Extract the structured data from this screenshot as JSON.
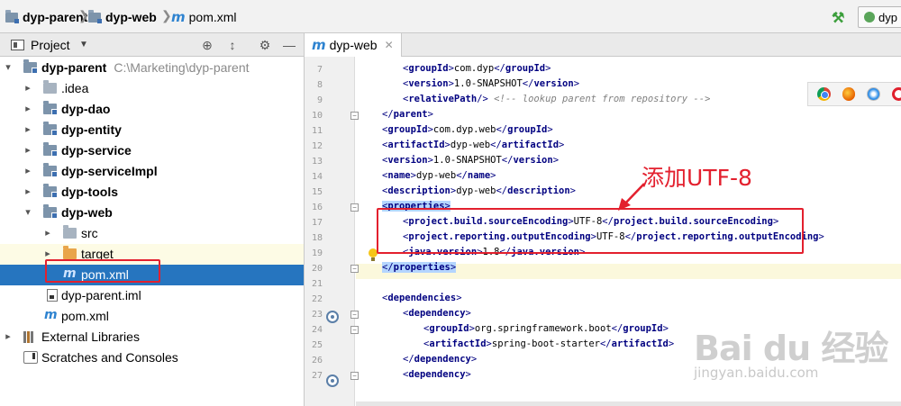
{
  "breadcrumb": {
    "items": [
      "dyp-parent",
      "dyp-web",
      "pom.xml"
    ]
  },
  "toolbar": {
    "run_config_label": "dyp"
  },
  "project_panel": {
    "title": "Project"
  },
  "tree": {
    "root_label": "dyp-parent",
    "root_path": "C:\\Marketing\\dyp-parent",
    "items": [
      {
        "label": ".idea"
      },
      {
        "label": "dyp-dao"
      },
      {
        "label": "dyp-entity"
      },
      {
        "label": "dyp-service"
      },
      {
        "label": "dyp-serviceImpl"
      },
      {
        "label": "dyp-tools"
      },
      {
        "label": "dyp-web"
      },
      {
        "label": "src"
      },
      {
        "label": "target"
      },
      {
        "label": "pom.xml"
      },
      {
        "label": "dyp-parent.iml"
      },
      {
        "label": "pom.xml"
      },
      {
        "label": "External Libraries"
      },
      {
        "label": "Scratches and Consoles"
      }
    ]
  },
  "editor": {
    "tab_label": "dyp-web",
    "line_numbers": [
      "7",
      "8",
      "9",
      "10",
      "11",
      "12",
      "13",
      "14",
      "15",
      "16",
      "17",
      "18",
      "19",
      "20",
      "21",
      "22",
      "23",
      "24",
      "25",
      "26",
      "27"
    ],
    "lines": {
      "l7": "com.dyp",
      "l8": "1.0-SNAPSHOT",
      "l9_comment": "<!-- lookup parent from repository -->",
      "l11": "com.dyp.web",
      "l12": "dyp-web",
      "l13": "1.0-SNAPSHOT",
      "l14": "dyp-web",
      "l15": "dyp-web",
      "l17": "UTF-8",
      "l18": "UTF-8",
      "l19": "1.8",
      "l24": "org.springframework.boot",
      "l25": "spring-boot-starter"
    }
  },
  "annotation": {
    "text": "添加UTF-8",
    "color": "#e3202e"
  },
  "watermark": {
    "main": "Bai du 经验",
    "sub": "jingyan.baidu.com"
  },
  "colors": {
    "selection": "#2675bf",
    "tag": "#000080",
    "highlight": "#e3202e"
  }
}
